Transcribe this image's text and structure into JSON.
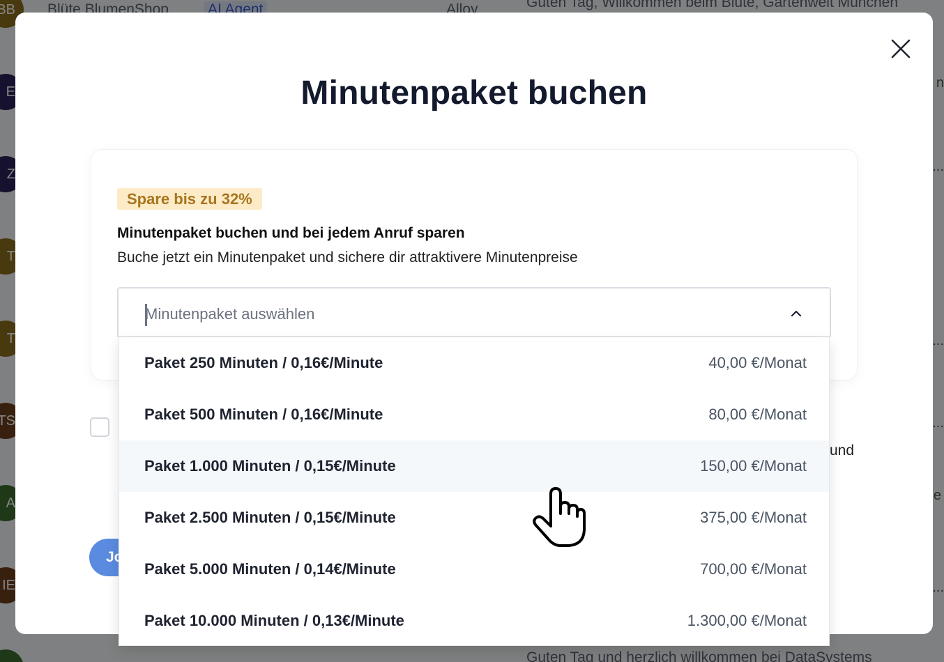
{
  "background": {
    "top_row": {
      "initials": "BB",
      "name": "Blüte BlumenShop",
      "tag": "AI Agent",
      "col3": "Alloy",
      "message": "Guten Tag, Willkommen beim Blüte, Gartenwelt München"
    },
    "avatars": [
      {
        "initials": "BB",
        "color": "#8a6d1e"
      },
      {
        "initials": "E",
        "color": "#2b2258"
      },
      {
        "initials": "Z",
        "color": "#2b2258"
      },
      {
        "initials": "T",
        "color": "#8a6d1e"
      },
      {
        "initials": "T",
        "color": "#8a6d1e"
      },
      {
        "initials": "TS",
        "color": "#6b3f1e"
      },
      {
        "initials": "A",
        "color": "#3a6b2e"
      },
      {
        "initials": "IE",
        "color": "#6b3f1e"
      },
      {
        "initials": "",
        "color": "#3a6b2e"
      }
    ],
    "right_fragments": [
      "n",
      "...",
      "...",
      "...",
      "und",
      "e",
      "..."
    ],
    "bottom_message": "Guten Tag und herzlich willkommen bei DataSystems"
  },
  "modal": {
    "title": "Minutenpaket buchen",
    "close_icon": "close-icon",
    "badge": "Spare bis zu 32%",
    "heading": "Minutenpaket buchen und bei jedem Anruf sparen",
    "subtext": "Buche jetzt ein Minutenpaket und sichere dir attraktivere Minutenpreise",
    "select": {
      "placeholder": "Minutenpaket auswählen",
      "expanded": true
    },
    "join_button_fragment": "Jo",
    "behind_text_fragment": "und",
    "options": [
      {
        "label": "Paket 250 Minuten / 0,16€/Minute",
        "price": "40,00 €/Monat",
        "hovered": false
      },
      {
        "label": "Paket 500 Minuten / 0,16€/Minute",
        "price": "80,00 €/Monat",
        "hovered": false
      },
      {
        "label": "Paket 1.000 Minuten / 0,15€/Minute",
        "price": "150,00 €/Monat",
        "hovered": true
      },
      {
        "label": "Paket 2.500 Minuten / 0,15€/Minute",
        "price": "375,00 €/Monat",
        "hovered": false
      },
      {
        "label": "Paket 5.000 Minuten / 0,14€/Minute",
        "price": "700,00 €/Monat",
        "hovered": false
      },
      {
        "label": "Paket 10.000 Minuten / 0,13€/Minute",
        "price": "1.300,00 €/Monat",
        "hovered": false
      }
    ],
    "accent_colors": {
      "badge_bg": "#fcebc6",
      "badge_text": "#a8751f",
      "button": "#5b8be0"
    }
  }
}
